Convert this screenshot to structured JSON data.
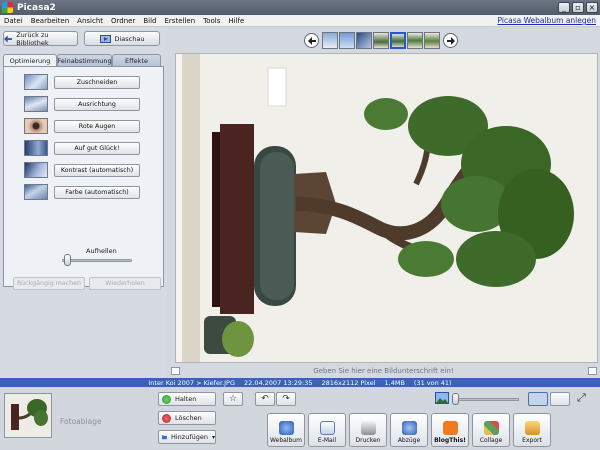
{
  "window": {
    "title": "Picasa2"
  },
  "menu": {
    "items": [
      "Datei",
      "Bearbeiten",
      "Ansicht",
      "Ordner",
      "Bild",
      "Erstellen",
      "Tools",
      "Hilfe"
    ],
    "web_link": "Picasa Webalbum anlegen"
  },
  "left": {
    "back_label": "Zurück zu Bibliothek",
    "slideshow_label": "Diaschau",
    "tabs": [
      "Optimierung",
      "Feinabstimmung",
      "Effekte"
    ],
    "tools": [
      "Zuschneiden",
      "Ausrichtung",
      "Rote Augen",
      "Auf gut Glück!",
      "Kontrast (automatisch)",
      "Farbe (automatisch)"
    ],
    "slider_label": "Aufhellen",
    "undo_label": "Rückgängig machen",
    "redo_label": "Wiederholen"
  },
  "viewer": {
    "caption_placeholder": "Geben Sie hier eine Bildunterschrift ein!"
  },
  "status": {
    "path": "Inter Koi 2007 > Kiefer.JPG",
    "date": "22.04.2007 13:29:35",
    "dimensions": "2816x2112 Pixel",
    "size": "1,4MB",
    "position": "(31 von 41)"
  },
  "tray": {
    "label": "Fotoablage",
    "hold": "Halten",
    "remove": "Löschen",
    "add": "Hinzufügen"
  },
  "actions": [
    "Webalbum",
    "E-Mail",
    "Drucken",
    "Abzüge",
    "BlogThis!",
    "Collage",
    "Export"
  ],
  "colors": {
    "status_bar": "#3a62b8",
    "link": "#1a2aa8",
    "accent": "#2c57c9"
  }
}
